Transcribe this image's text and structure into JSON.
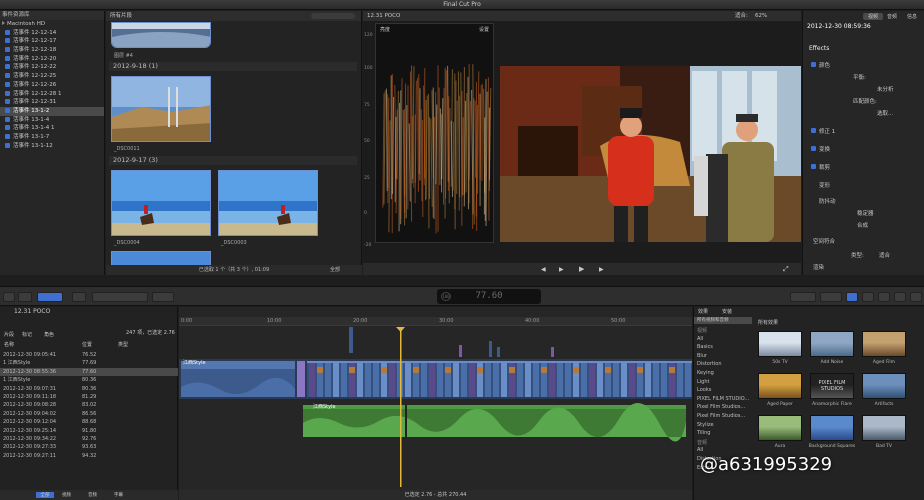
{
  "window": {
    "title": "Final Cut Pro"
  },
  "library": {
    "header": "事件资源库",
    "disk": "Macintosh HD",
    "items": [
      "活事件 12-12-14",
      "活事件 12-12-17",
      "活事件 12-12-18",
      "活事件 12-12-20",
      "活事件 12-12-22",
      "活事件 12-12-25",
      "活事件 12-12-26",
      "活事件 12-12-28 1",
      "活事件 12-12-31",
      "活事件 13-1-2",
      "活事件 13-1-4",
      "活事件 13-1-4 1",
      "活事件 13-1-7",
      "活事件 13-1-12"
    ],
    "selected_index": 9
  },
  "browser": {
    "header": "所有片段",
    "top_clip_label": "图层 #4",
    "groups": [
      {
        "title": "2012-9-18  (1)",
        "clips": [
          "_DSC0011"
        ]
      },
      {
        "title": "2012-9-17  (3)",
        "clips": [
          "_DSC0004",
          "_DSC0003"
        ]
      }
    ],
    "footer": "已选取 1 个（共 3 个）, 01:09",
    "zoom_label": "全部"
  },
  "viewer": {
    "title": "12.31 POCO",
    "zoom_label": "适合:",
    "zoom_value": "62%",
    "scope_title": "亮度",
    "scope_settings": "设置",
    "scope_scale": [
      "120",
      "100",
      "75",
      "50",
      "25",
      "0",
      "-20"
    ]
  },
  "inspector": {
    "tabs": [
      "视频",
      "音频",
      "信息"
    ],
    "timecode": "2012-12-30 08:59:36",
    "effects_header": "Effects",
    "rows": [
      "颜色",
      "平衡:",
      "未分析",
      "匹配颜色:",
      "选取...",
      "修正 1",
      "变换",
      "裁剪",
      "变形",
      "防抖动",
      "稳定器",
      "合成",
      "空间符合",
      "类型:",
      "适合",
      "渲染",
      "帧混合"
    ]
  },
  "toolbar": {
    "timecode": "77.60",
    "badge": "100"
  },
  "timeline_index": {
    "title": "12.31  POCO",
    "tabs": [
      "片段",
      "标记",
      "角色"
    ],
    "count": "247 项，已选定 2.76",
    "columns": [
      "名称",
      "位置",
      "类型"
    ],
    "rows": [
      [
        "2012-12-30 09:05:41",
        "76.52"
      ],
      [
        "1 江西Style",
        "77.69"
      ],
      [
        "2012-12-30 08:55:36",
        "77.60"
      ],
      [
        "1 江西Style",
        "80.36"
      ],
      [
        "2012-12-30 09:07:31",
        "80.36"
      ],
      [
        "2012-12-30 09:11:18",
        "81.29"
      ],
      [
        "2012-12-30 09:08:28",
        "83.02"
      ],
      [
        "2012-12-30 09:04:02",
        "86.56"
      ],
      [
        "2012-12-30 09:12:04",
        "88.68"
      ],
      [
        "2012-12-30 09:25:14",
        "91.80"
      ],
      [
        "2012-12-30 09:34:22",
        "92.76"
      ],
      [
        "2012-12-30 09:27:33",
        "93.63"
      ],
      [
        "2012-12-30 09:27:11",
        "94.32"
      ]
    ],
    "selected_row": 2,
    "footer_tabs": [
      "全部",
      "视频",
      "音频",
      "字幕"
    ]
  },
  "timeline": {
    "ruler": [
      "0:00",
      "10:00",
      "20:00",
      "30:00",
      "40:00",
      "50:00",
      "1:00:00",
      "1:10:00"
    ],
    "main_clip_label": "江西Style",
    "audio_label": "江西Style",
    "footer": "已选定 2.76 - 总共 270.44"
  },
  "effects": {
    "tabs": [
      "效果",
      "安装"
    ],
    "categories_header": "所有视频和音频",
    "categories": [
      "视频",
      "All",
      "Basics",
      "Blur",
      "Distortion",
      "Keying",
      "Light",
      "Looks",
      "PIXEL FILM STUDIO...",
      "Pixel Film Studios...",
      "Pixel Film Studios...",
      "Stylize",
      "Tiling",
      "音频",
      "All",
      "Distortion",
      "Echo"
    ],
    "section": "所有效果",
    "items": [
      "50s TV",
      "Add Noise",
      "Aged Film",
      "Aged Paper",
      "Anamorphic Flare",
      "Artifacts",
      "Aura",
      "Background Squares",
      "Bad TV"
    ],
    "pfs_text": "PIXEL FILM STUDIOS"
  },
  "watermark": "@a631995329"
}
